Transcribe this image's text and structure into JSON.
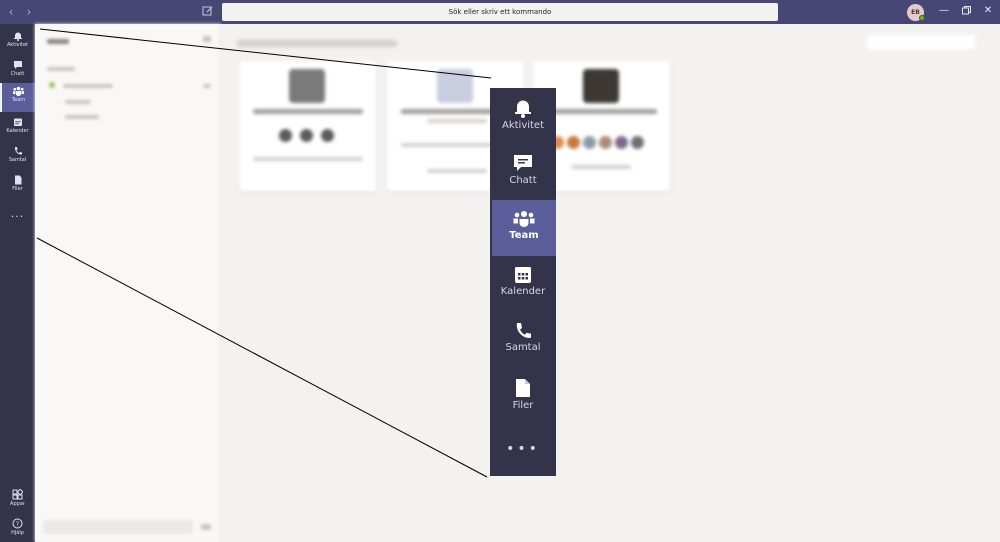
{
  "titlebar": {
    "back_icon": "chevron-left-icon",
    "forward_icon": "chevron-right-icon",
    "compose_icon": "compose-icon",
    "search_placeholder": "Sök eller skriv ett kommando",
    "avatar_initials": "EB",
    "presence_color": "#6bb700",
    "window_controls": [
      "minimize-icon",
      "restore-icon",
      "close-icon"
    ]
  },
  "colors": {
    "titlebar": "#464775",
    "rail": "#33344a",
    "active_item": "#5b5e9a",
    "background": "#f3f2f1"
  },
  "rail": {
    "items": [
      {
        "label": "Aktivitet",
        "icon": "bell-icon"
      },
      {
        "label": "Chatt",
        "icon": "chat-icon"
      },
      {
        "label": "Team",
        "icon": "teams-icon",
        "active": true
      },
      {
        "label": "Kalender",
        "icon": "calendar-icon"
      },
      {
        "label": "Samtal",
        "icon": "phone-icon"
      },
      {
        "label": "Filer",
        "icon": "file-icon"
      }
    ],
    "more_label": "...",
    "bottom": [
      {
        "label": "Appar",
        "icon": "apps-icon"
      },
      {
        "label": "Hjälp",
        "icon": "help-icon"
      }
    ]
  },
  "zoom_callout": {
    "items": [
      {
        "label": "Aktivitet",
        "icon": "bell-icon"
      },
      {
        "label": "Chatt",
        "icon": "chat-icon"
      },
      {
        "label": "Team",
        "icon": "teams-icon",
        "active": true
      },
      {
        "label": "Kalender",
        "icon": "calendar-icon"
      },
      {
        "label": "Samtal",
        "icon": "phone-icon"
      },
      {
        "label": "Filer",
        "icon": "file-icon"
      }
    ],
    "more_label": "•••"
  }
}
